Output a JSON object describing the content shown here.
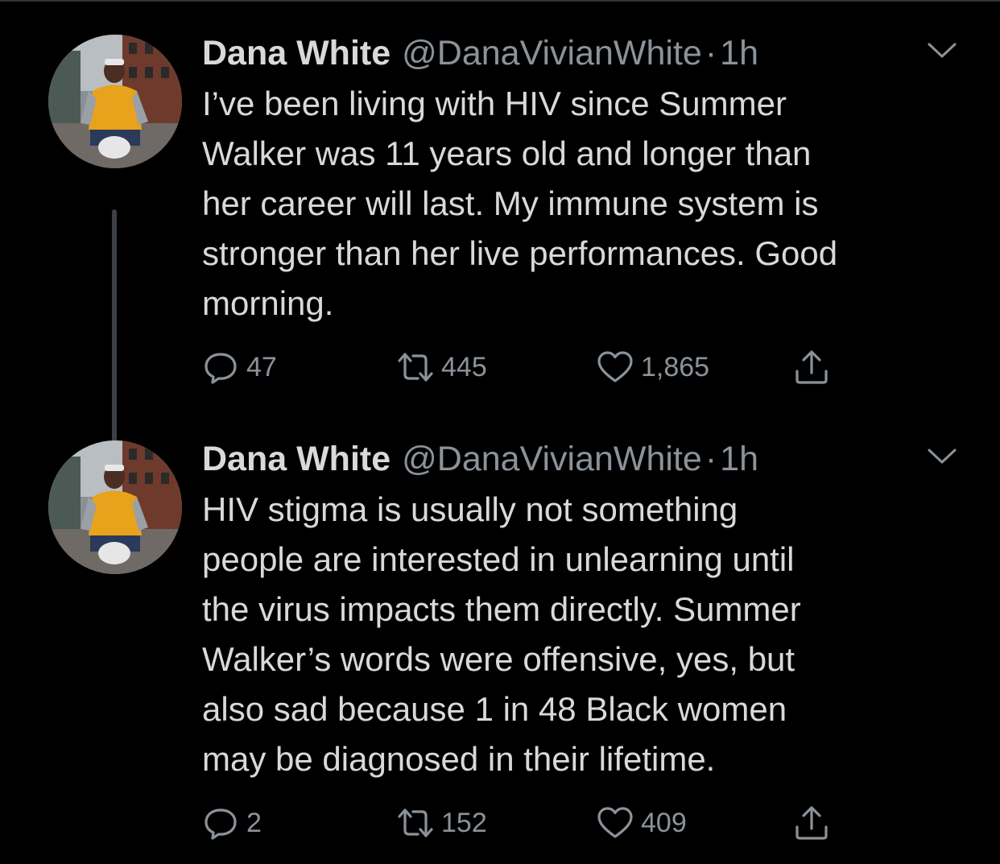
{
  "tweets": [
    {
      "name": "Dana White",
      "handle": "@DanaVivianWhite",
      "separator": "·",
      "time": "1h",
      "text_lines": [
        "I’ve been living with HIV since Summer",
        "Walker was 11 years old and longer than",
        "her career will last. My immune system is",
        "stronger than her live performances. Good",
        "morning."
      ],
      "replies": "47",
      "retweets": "445",
      "likes": "1,865"
    },
    {
      "name": "Dana White",
      "handle": "@DanaVivianWhite",
      "separator": "·",
      "time": "1h",
      "text_lines": [
        "HIV stigma is usually not something",
        "people are interested in unlearning until",
        "the virus impacts them directly. Summer",
        "Walker’s words were offensive, yes, but",
        "also sad because 1 in 48 Black women",
        "may be diagnosed in their lifetime."
      ],
      "replies": "2",
      "retweets": "152",
      "likes": "409"
    }
  ],
  "icons": {
    "reply": "reply-icon",
    "retweet": "retweet-icon",
    "like": "heart-icon",
    "share": "share-icon",
    "menu": "chevron-down-icon"
  },
  "colors": {
    "background": "#000000",
    "text": "#d9d9d9",
    "muted": "#8b9299",
    "thread_line": "#3d4146"
  }
}
